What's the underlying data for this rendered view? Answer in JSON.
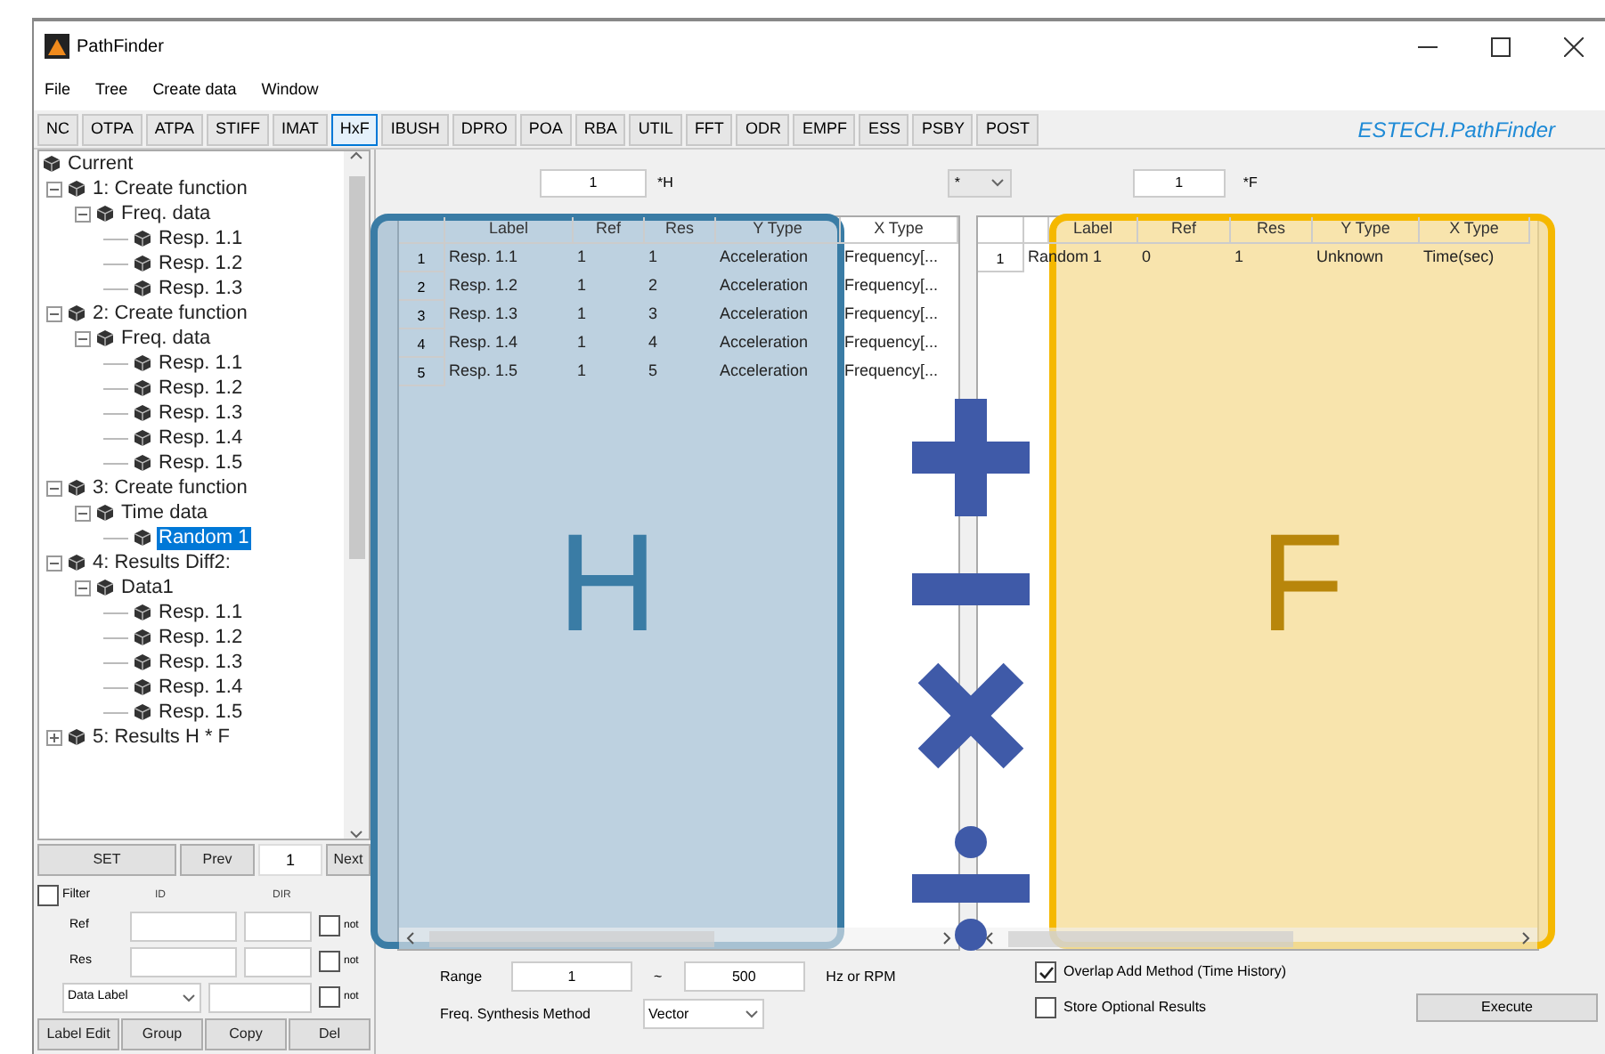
{
  "window": {
    "title": "PathFinder"
  },
  "menu": [
    "File",
    "Tree",
    "Create data",
    "Window"
  ],
  "toolbar": {
    "tabs": [
      {
        "label": "NC",
        "selected": false
      },
      {
        "label": "OTPA",
        "selected": false
      },
      {
        "label": "ATPA",
        "selected": false
      },
      {
        "label": "STIFF",
        "selected": false
      },
      {
        "label": "IMAT",
        "selected": false
      },
      {
        "label": "HxF",
        "selected": true
      },
      {
        "label": "IBUSH",
        "selected": false
      },
      {
        "label": "DPRO",
        "selected": false
      },
      {
        "label": "POA",
        "selected": false
      },
      {
        "label": "RBA",
        "selected": false
      },
      {
        "label": "UTIL",
        "selected": false
      },
      {
        "label": "FFT",
        "selected": false
      },
      {
        "label": "ODR",
        "selected": false
      },
      {
        "label": "EMPF",
        "selected": false
      },
      {
        "label": "ESS",
        "selected": false
      },
      {
        "label": "PSBY",
        "selected": false
      },
      {
        "label": "POST",
        "selected": false
      }
    ],
    "brand": "ESTECH.PathFinder"
  },
  "tree": [
    {
      "label": "Current",
      "selected": false,
      "children": [
        {
          "label": "1: Create function",
          "selected": false,
          "expanded": true,
          "children": [
            {
              "label": "Freq. data",
              "selected": false,
              "expanded": true,
              "children": [
                {
                  "label": "Resp. 1.1",
                  "selected": false
                },
                {
                  "label": "Resp. 1.2",
                  "selected": false
                },
                {
                  "label": "Resp. 1.3",
                  "selected": false
                }
              ]
            }
          ]
        },
        {
          "label": "2: Create function",
          "selected": false,
          "expanded": true,
          "children": [
            {
              "label": "Freq. data",
              "selected": false,
              "expanded": true,
              "children": [
                {
                  "label": "Resp. 1.1",
                  "selected": false
                },
                {
                  "label": "Resp. 1.2",
                  "selected": false
                },
                {
                  "label": "Resp. 1.3",
                  "selected": false
                },
                {
                  "label": "Resp. 1.4",
                  "selected": false
                },
                {
                  "label": "Resp. 1.5",
                  "selected": false
                }
              ]
            }
          ]
        },
        {
          "label": "3: Create function",
          "selected": false,
          "expanded": true,
          "children": [
            {
              "label": "Time data",
              "selected": false,
              "expanded": true,
              "children": [
                {
                  "label": "Random 1",
                  "selected": true
                }
              ]
            }
          ]
        },
        {
          "label": "4: Results Diff2:",
          "selected": false,
          "expanded": true,
          "children": [
            {
              "label": "Data1",
              "selected": false,
              "expanded": true,
              "children": [
                {
                  "label": "Resp. 1.1",
                  "selected": false
                },
                {
                  "label": "Resp. 1.2",
                  "selected": false
                },
                {
                  "label": "Resp. 1.3",
                  "selected": false
                },
                {
                  "label": "Resp. 1.4",
                  "selected": false
                },
                {
                  "label": "Resp. 1.5",
                  "selected": false
                }
              ]
            }
          ]
        },
        {
          "label": "5: Results H * F",
          "selected": false,
          "expanded": false
        }
      ]
    }
  ],
  "navigation": {
    "set": "SET",
    "prev": "Prev",
    "index": "1",
    "next": "Next"
  },
  "filter": {
    "label": "Filter",
    "checked": false,
    "columns": [
      "ID",
      "DIR"
    ],
    "rows": [
      {
        "kind": "text",
        "label": "Ref",
        "not_label": "not",
        "not": false
      },
      {
        "kind": "text",
        "label": "Res",
        "not_label": "not",
        "not": false
      },
      {
        "kind": "dropdown",
        "label": "Data Label",
        "not_label": "not",
        "not": false
      }
    ]
  },
  "tree_buttons": [
    "Label Edit",
    "Group",
    "Copy",
    "Del"
  ],
  "h_factor": {
    "value": "1",
    "label": "*H"
  },
  "operator": {
    "value": "*"
  },
  "f_factor": {
    "value": "1",
    "label": "*F"
  },
  "h_table": {
    "columns": [
      "Label",
      "Ref",
      "Res",
      "Y Type",
      "X Type"
    ],
    "rows": [
      {
        "number": "1",
        "cells": [
          "Resp. 1.1",
          "1",
          "1",
          "Acceleration",
          "Frequency[..."
        ]
      },
      {
        "number": "2",
        "cells": [
          "Resp. 1.2",
          "1",
          "2",
          "Acceleration",
          "Frequency[..."
        ]
      },
      {
        "number": "3",
        "cells": [
          "Resp. 1.3",
          "1",
          "3",
          "Acceleration",
          "Frequency[..."
        ]
      },
      {
        "number": "4",
        "cells": [
          "Resp. 1.4",
          "1",
          "4",
          "Acceleration",
          "Frequency[..."
        ]
      },
      {
        "number": "5",
        "cells": [
          "Resp. 1.5",
          "1",
          "5",
          "Acceleration",
          "Frequency[..."
        ]
      }
    ]
  },
  "f_table": {
    "columns": [
      "Label",
      "Ref",
      "Res",
      "Y Type",
      "X Type"
    ],
    "rows": [
      {
        "number": "1",
        "cells": [
          "Random 1",
          "0",
          "1",
          "Unknown",
          "Time(sec)"
        ]
      }
    ]
  },
  "range": {
    "label": "Range",
    "from": "1",
    "separator": "~",
    "to": "500",
    "unit": "Hz or RPM"
  },
  "synthesis": {
    "label": "Freq. Synthesis Method",
    "value": "Vector"
  },
  "options": [
    {
      "label": "Overlap Add Method (Time History)",
      "checked": true
    },
    {
      "label": "Store Optional Results",
      "checked": false
    }
  ],
  "execute": "Execute",
  "overlay": {
    "h_letter": "H",
    "f_letter": "F",
    "operators": [
      {
        "kind": "plus"
      },
      {
        "kind": "minus"
      },
      {
        "kind": "times"
      },
      {
        "kind": "divide"
      }
    ]
  }
}
